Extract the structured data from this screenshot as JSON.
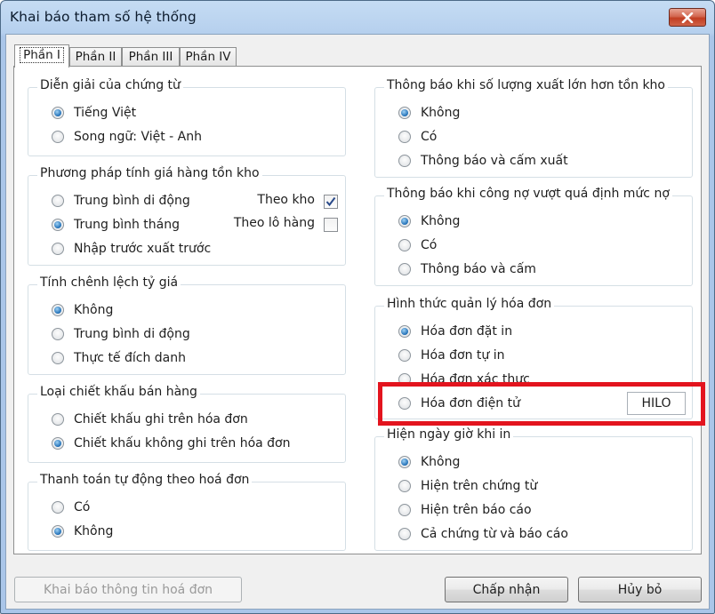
{
  "window": {
    "title": "Khai báo tham số hệ thống"
  },
  "tabs": [
    "Phần I",
    "Phần II",
    "Phần III",
    "Phần IV"
  ],
  "groups": {
    "dien_giai": {
      "legend": "Diễn giải của chứng từ",
      "options": [
        "Tiếng Việt",
        "Song ngữ: Việt - Anh"
      ]
    },
    "phuong_phap": {
      "legend": "Phương pháp tính giá hàng tồn kho",
      "options": [
        "Trung bình di động",
        "Trung bình tháng",
        "Nhập trước xuất trước"
      ],
      "theo_kho": "Theo kho",
      "theo_lo_hang": "Theo lô hàng"
    },
    "chenh_lech": {
      "legend": "Tính chênh lệch tỷ giá",
      "options": [
        "Không",
        "Trung bình di động",
        "Thực tế đích danh"
      ]
    },
    "chiet_khau": {
      "legend": "Loại chiết khấu bán hàng",
      "options": [
        "Chiết khấu ghi trên hóa đơn",
        "Chiết khấu không ghi trên hóa đơn"
      ]
    },
    "thanh_toan": {
      "legend": "Thanh toán tự động theo hoá đơn",
      "options": [
        "Có",
        "Không"
      ]
    },
    "so_luong_xuat": {
      "legend": "Thông báo khi số lượng xuất lớn hơn tồn kho",
      "options": [
        "Không",
        "Có",
        "Thông báo và cấm xuất"
      ]
    },
    "cong_no": {
      "legend": "Thông báo khi công nợ vượt quá định mức nợ",
      "options": [
        "Không",
        "Có",
        "Thông báo và cấm"
      ]
    },
    "hoa_don": {
      "legend": "Hình thức quản lý hóa đơn",
      "options": [
        "Hóa đơn đặt in",
        "Hóa đơn tự in",
        "Hóa đơn xác thực",
        "Hóa đơn điện tử"
      ],
      "provider": "HILO"
    },
    "ngay_gio": {
      "legend": "Hiện ngày giờ khi in",
      "options": [
        "Không",
        "Hiện trên chứng từ",
        "Hiện trên báo cáo",
        "Cả chứng từ và báo cáo"
      ]
    }
  },
  "buttons": {
    "khai_bao": "Khai báo thông tin hoá đơn",
    "chap_nhan": "Chấp nhận",
    "huy_bo": "Hủy bỏ"
  },
  "colors": {
    "highlight": "#e3141e",
    "radio_selected": "#1e6db5",
    "close_button": "#c23e22"
  }
}
